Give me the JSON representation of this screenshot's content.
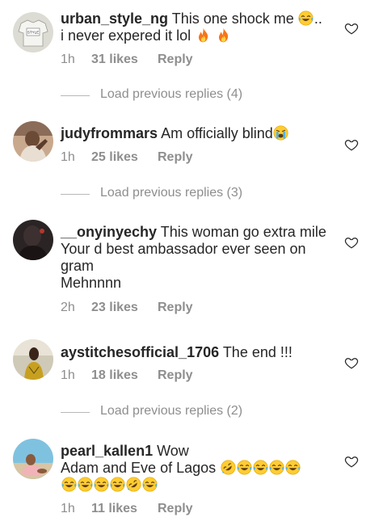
{
  "comments": [
    {
      "username": "urban_style_ng",
      "text_before": "This one shock me",
      "text_after": ".. i never expered it lol",
      "time": "1h",
      "likes": "31 likes",
      "reply": "Reply",
      "avatar_text": "STYLE"
    },
    {
      "username": "judyfrommars",
      "text": "Am officially blind",
      "time": "1h",
      "likes": "25 likes",
      "reply": "Reply"
    },
    {
      "username": "__onyinyechy",
      "line1": "This woman go extra mile",
      "line2": "Your d best ambassador ever seen on",
      "line3": "gram",
      "line4": "Mehnnnn",
      "time": "2h",
      "likes": "23 likes",
      "reply": "Reply"
    },
    {
      "username": "aystitchesofficial_1706",
      "text": "The end !!!",
      "time": "1h",
      "likes": "18 likes",
      "reply": "Reply"
    },
    {
      "username": "pearl_kallen1",
      "line1": "Wow",
      "line2": "Adam and Eve of Lagos",
      "time": "1h",
      "likes": "11 likes",
      "reply": "Reply"
    }
  ],
  "load_replies": [
    "Load previous replies (4)",
    "Load previous replies (3)",
    "Load previous replies (2)"
  ],
  "colors": {
    "text": "#262626",
    "meta": "#8e8e8e",
    "emoji_face": "#ffcc33",
    "fire": "#f5761a"
  }
}
